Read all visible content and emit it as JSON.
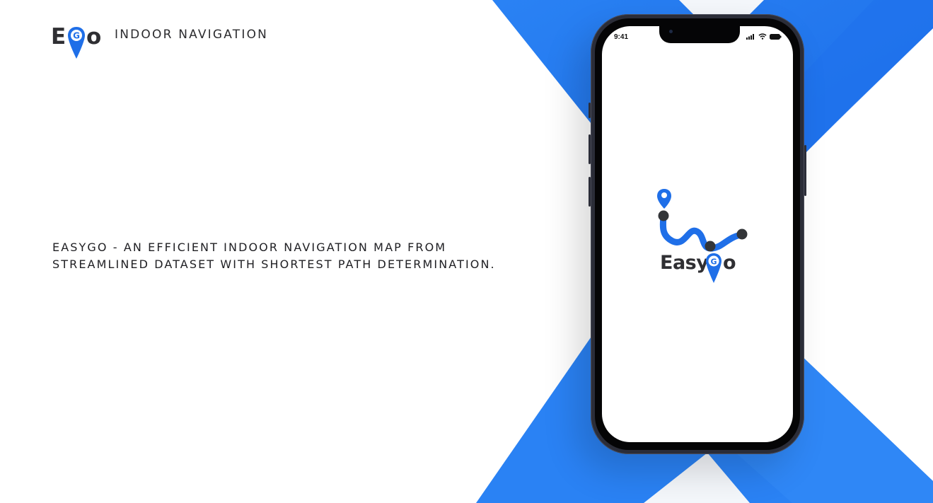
{
  "brand": {
    "logo_letter_left": "E",
    "logo_letter_pin": "G",
    "logo_letter_right": "o",
    "title": "INDOOR NAVIGATION"
  },
  "headline": {
    "line1": "EASYGO - AN EFFICIENT INDOOR NAVIGATION MAP FROM",
    "line2": "STREAMLINED DATASET WITH SHORTEST PATH DETERMINATION."
  },
  "phone": {
    "status_time": "9:41",
    "splash": {
      "word": "Easy",
      "pin_letter": "G",
      "word_end": "o"
    }
  },
  "colors": {
    "accent": "#1f6fe8",
    "accent_light": "#2e86f5",
    "text_dark": "#2f2f33",
    "phone_frame": "#2b2d38"
  },
  "icons": [
    "location-pin-icon",
    "signal-icon",
    "wifi-icon",
    "battery-icon",
    "route-path-icon"
  ]
}
